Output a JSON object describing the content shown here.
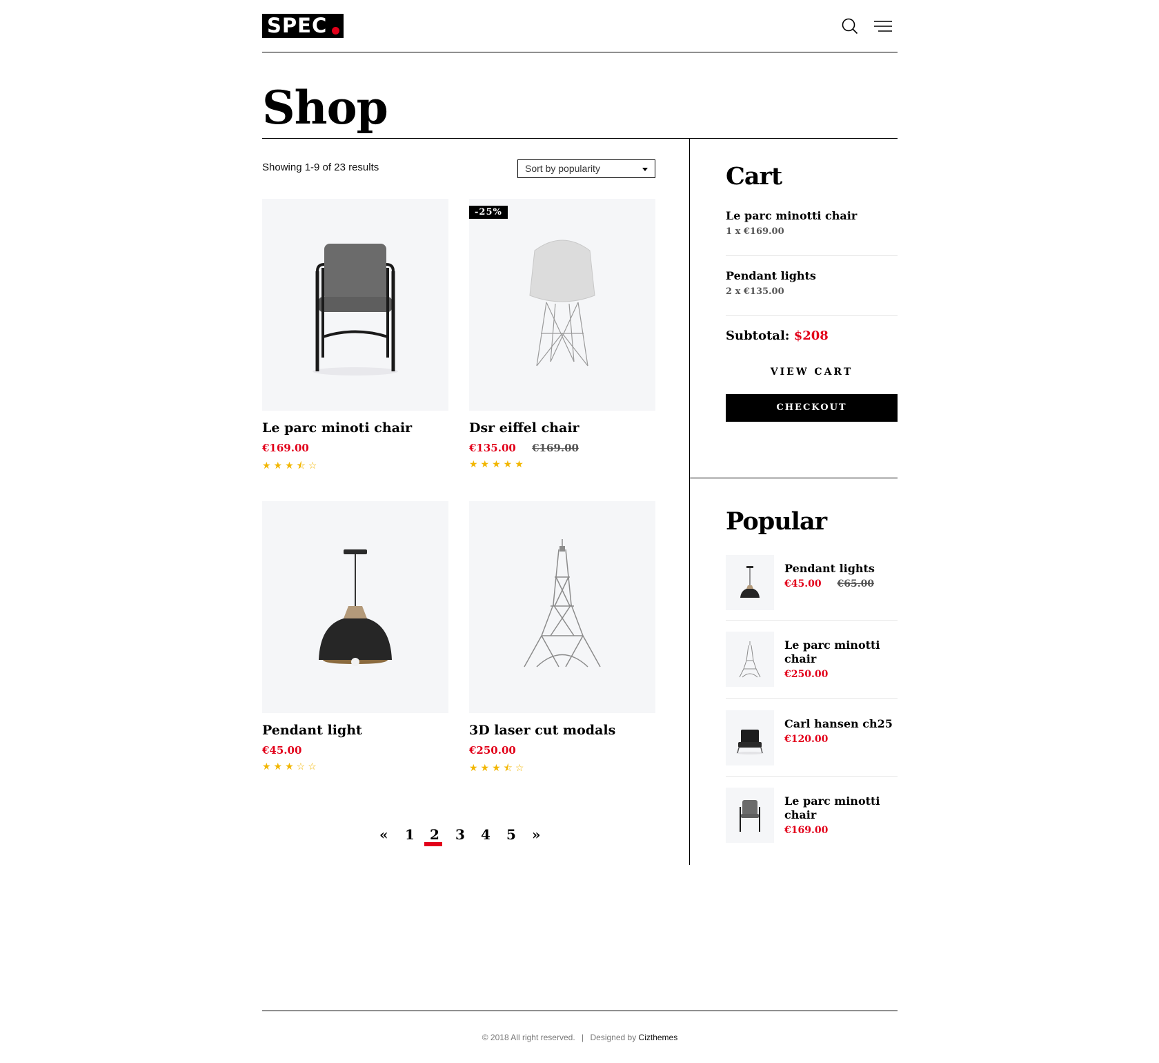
{
  "header": {
    "logo_text": "SPEC",
    "search_icon": "search-icon",
    "menu_icon": "menu-icon"
  },
  "page": {
    "title": "Shop"
  },
  "toolbar": {
    "results": "Showing 1-9 of 23 results",
    "sort_label": "Sort by popularity"
  },
  "products": [
    {
      "name": "Le parc minoti chair",
      "price": "€169.00",
      "old_price": "",
      "badge": "",
      "rating": 3.5,
      "stars": "★★★⯪☆"
    },
    {
      "name": "Dsr eiffel chair",
      "price": "€135.00",
      "old_price": "€169.00",
      "badge": "-25%",
      "rating": 5,
      "stars": "★★★★★"
    },
    {
      "name": "Pendant light",
      "price": "€45.00",
      "old_price": "",
      "badge": "",
      "rating": 3,
      "stars": "★★★☆☆"
    },
    {
      "name": "3D laser cut modals",
      "price": "€250.00",
      "old_price": "",
      "badge": "",
      "rating": 3.5,
      "stars": "★★★⯪☆"
    }
  ],
  "pagination": {
    "prev": "«",
    "pages": [
      "1",
      "2",
      "3",
      "4",
      "5"
    ],
    "current": "2",
    "next": "»"
  },
  "cart": {
    "title": "Cart",
    "items": [
      {
        "name": "Le parc minotti chair",
        "qty": "1 x €169.00"
      },
      {
        "name": "Pendant lights",
        "qty": "2 x €135.00"
      }
    ],
    "subtotal_label": "Subtotal:",
    "subtotal_value": "$208",
    "view_cart": "VIEW CART",
    "checkout": "CHECKOUT"
  },
  "popular": {
    "title": "Popular",
    "items": [
      {
        "name": "Pendant lights",
        "price": "€45.00",
        "old_price": "€65.00"
      },
      {
        "name": "Le parc minotti chair",
        "price": "€250.00",
        "old_price": ""
      },
      {
        "name": "Carl hansen ch25",
        "price": "€120.00",
        "old_price": ""
      },
      {
        "name": "Le parc minotti chair",
        "price": "€169.00",
        "old_price": ""
      }
    ]
  },
  "footer": {
    "copyright": "© 2018 All right reserved.",
    "separator": "|",
    "designed_by": "Designed by",
    "brand": "Cizthemes"
  },
  "colors": {
    "accent": "#e2001a",
    "star": "#f2b600",
    "image_bg": "#f5f6f8"
  }
}
